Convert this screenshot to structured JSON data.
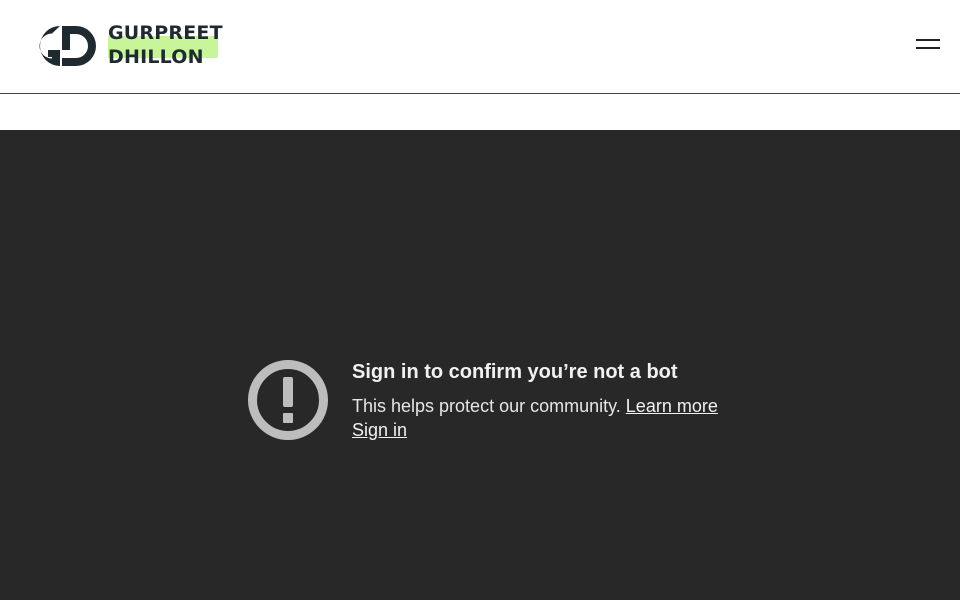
{
  "header": {
    "logo": {
      "line1": "GURPREET",
      "line2": "DHILLON",
      "mark_icon": "gd-monogram-icon",
      "accent_color": "#c8f59a",
      "text_color": "#1e2a30"
    },
    "menu_icon": "hamburger-menu-icon"
  },
  "player": {
    "background": "#282828",
    "alert_icon": "exclamation-circle-icon",
    "title": "Sign in to confirm you’re not a bot",
    "message": "This helps protect our community.",
    "learn_more_label": "Learn more",
    "sign_in_label": "Sign in"
  }
}
